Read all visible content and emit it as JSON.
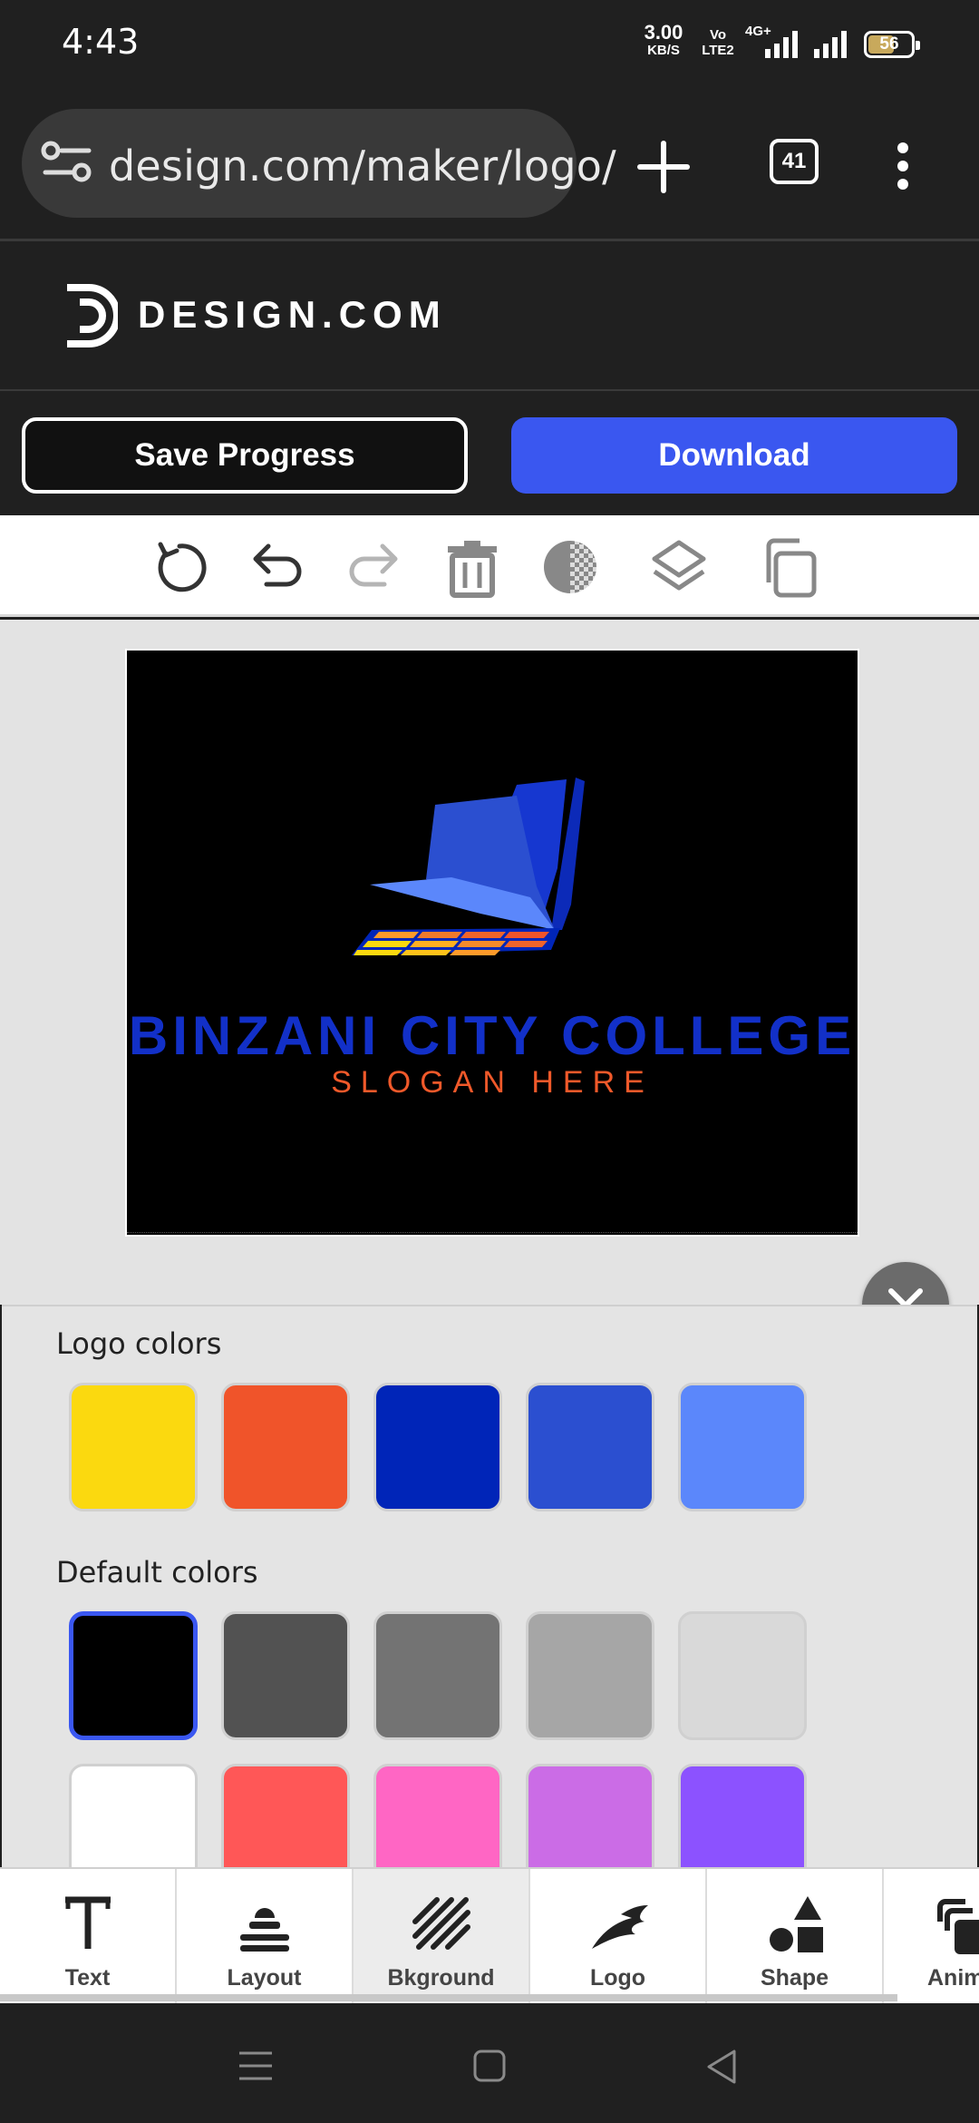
{
  "status_bar": {
    "time": "4:43",
    "net_speed": "3.00",
    "net_speed_unit": "KB/S",
    "volte": "Vo LTE2",
    "network": "4G+",
    "battery": "56"
  },
  "browser": {
    "url": "design.com/maker/logo/",
    "tab_count": "41"
  },
  "site": {
    "brand": "DESIGN.COM"
  },
  "actions": {
    "save_label": "Save Progress",
    "download_label": "Download"
  },
  "toolbar": {
    "tools": [
      "reset-icon",
      "undo-icon",
      "redo-icon",
      "trash-icon",
      "transparency-icon",
      "layers-icon",
      "duplicate-icon"
    ]
  },
  "logo": {
    "title": "BINZANI CITY COLLEGE",
    "slogan": "SLOGAN HERE"
  },
  "color_panel": {
    "logo_colors_label": "Logo colors",
    "logo_colors": [
      "#fbd90f",
      "#f0542a",
      "#0025b8",
      "#2b4fd0",
      "#5b87fb"
    ],
    "default_colors_label": "Default colors",
    "default_colors_row1": [
      "#000000",
      "#525252",
      "#737373",
      "#a6a6a6",
      "#d9d9d9"
    ],
    "default_colors_row2": [
      "#ffffff",
      "#ff5757",
      "#ff66c4",
      "#cb6ce6",
      "#8c52ff"
    ],
    "selected_color": "#000000"
  },
  "bottom_nav": {
    "items": [
      {
        "label": "Text",
        "icon": "text-icon"
      },
      {
        "label": "Layout",
        "icon": "layout-icon"
      },
      {
        "label": "Bkground",
        "icon": "background-icon"
      },
      {
        "label": "Logo",
        "icon": "logo-icon"
      },
      {
        "label": "Shape",
        "icon": "shape-icon"
      },
      {
        "label": "Anim",
        "icon": "animation-icon"
      }
    ],
    "active": "Bkground"
  }
}
